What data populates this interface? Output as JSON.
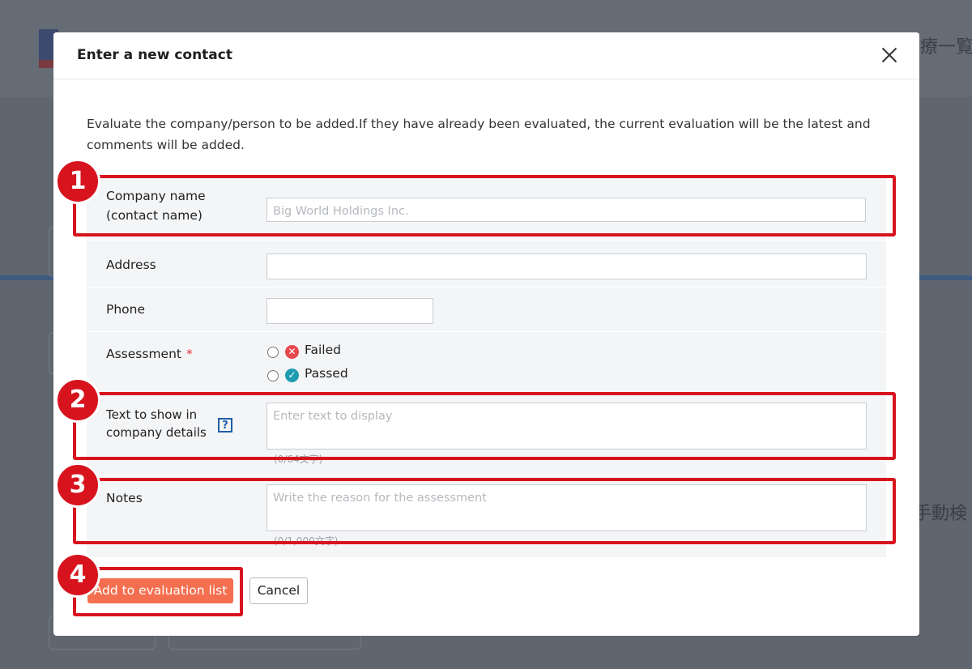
{
  "background": {
    "header_text_right": "療一覧",
    "side_text_right": "手動検"
  },
  "modal": {
    "title": "Enter a new contact",
    "intro": "Evaluate the company/person to be added.If they have already been evaluated, the current evaluation will be the latest and comments will be added.",
    "fields": {
      "company": {
        "label_line1": "Company name",
        "label_line2": "(contact name)",
        "placeholder": "Big World Holdings Inc."
      },
      "address": {
        "label": "Address",
        "value": ""
      },
      "phone": {
        "label": "Phone",
        "value": ""
      },
      "assessment": {
        "label": "Assessment",
        "required_mark": "*",
        "options": [
          {
            "label": "Failed",
            "icon": "x-circle-icon",
            "color": "#e5484d"
          },
          {
            "label": "Passed",
            "icon": "check-circle-icon",
            "color": "#1f9bb0"
          }
        ]
      },
      "display_text": {
        "label_line1": "Text to show in",
        "label_line2": "company details",
        "help": "?",
        "placeholder": "Enter text to display",
        "counter": "(0/64文字)"
      },
      "notes": {
        "label": "Notes",
        "placeholder": "Write the reason for the assessment",
        "counter": "(0/1,000文字)"
      }
    },
    "buttons": {
      "submit": "Add to evaluation list",
      "cancel": "Cancel"
    }
  },
  "annotations": [
    "1",
    "2",
    "3",
    "4"
  ],
  "colors": {
    "highlight": "#d7141e",
    "primary_button": "#f46f4f"
  }
}
